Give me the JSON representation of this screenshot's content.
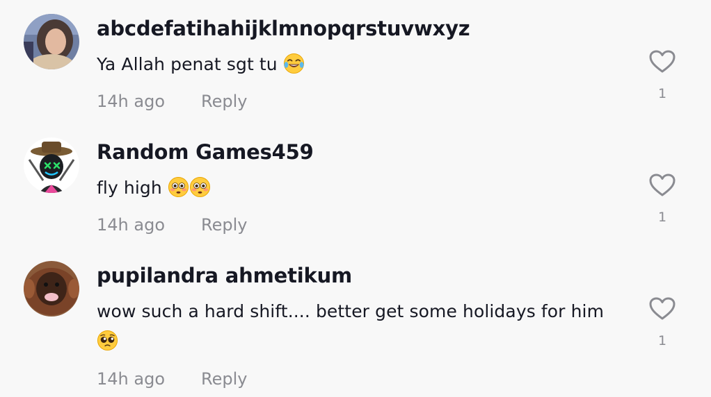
{
  "comments": [
    {
      "username": "abcdefatihahijklmnopqrstuvwxyz",
      "text": "Ya Allah penat sgt tu",
      "emoji": [
        "face-with-tears-of-joy"
      ],
      "time": "14h ago",
      "reply_label": "Reply",
      "like_count": "1"
    },
    {
      "username": "Random Games459",
      "text": "fly high",
      "emoji": [
        "flushed-face",
        "flushed-face"
      ],
      "time": "14h ago",
      "reply_label": "Reply",
      "like_count": "1"
    },
    {
      "username": "pupilandra ahmetikum",
      "text": "wow such a hard shift.... better get some holidays for him",
      "emoji": [
        "pleading-face"
      ],
      "time": "14h ago",
      "reply_label": "Reply",
      "like_count": "1"
    }
  ],
  "icons": {
    "like": "heart-outline-icon"
  },
  "colors": {
    "background": "#f8f8f8",
    "username": "#161823",
    "text": "#161823",
    "meta": "#8a8b91"
  }
}
